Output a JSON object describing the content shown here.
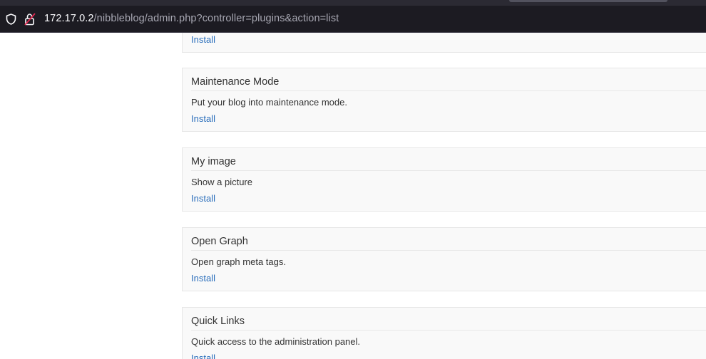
{
  "browser": {
    "url_host": "172.17.0.2",
    "url_path": "/nibbleblog/admin.php?controller=plugins&action=list",
    "icons": {
      "shield": "shield-icon",
      "lock": "lock-icon"
    }
  },
  "plugins": [
    {
      "title": "",
      "description": "",
      "install_label": "Install"
    },
    {
      "title": "Maintenance Mode",
      "description": "Put your blog into maintenance mode.",
      "install_label": "Install"
    },
    {
      "title": "My image",
      "description": "Show a picture",
      "install_label": "Install"
    },
    {
      "title": "Open Graph",
      "description": "Open graph meta tags.",
      "install_label": "Install"
    },
    {
      "title": "Quick Links",
      "description": "Quick access to the administration panel.",
      "install_label": "Install"
    }
  ],
  "colors": {
    "link": "#2a6ebb",
    "card_bg": "#f9f9f9",
    "chrome_bg": "#1c1b22"
  }
}
